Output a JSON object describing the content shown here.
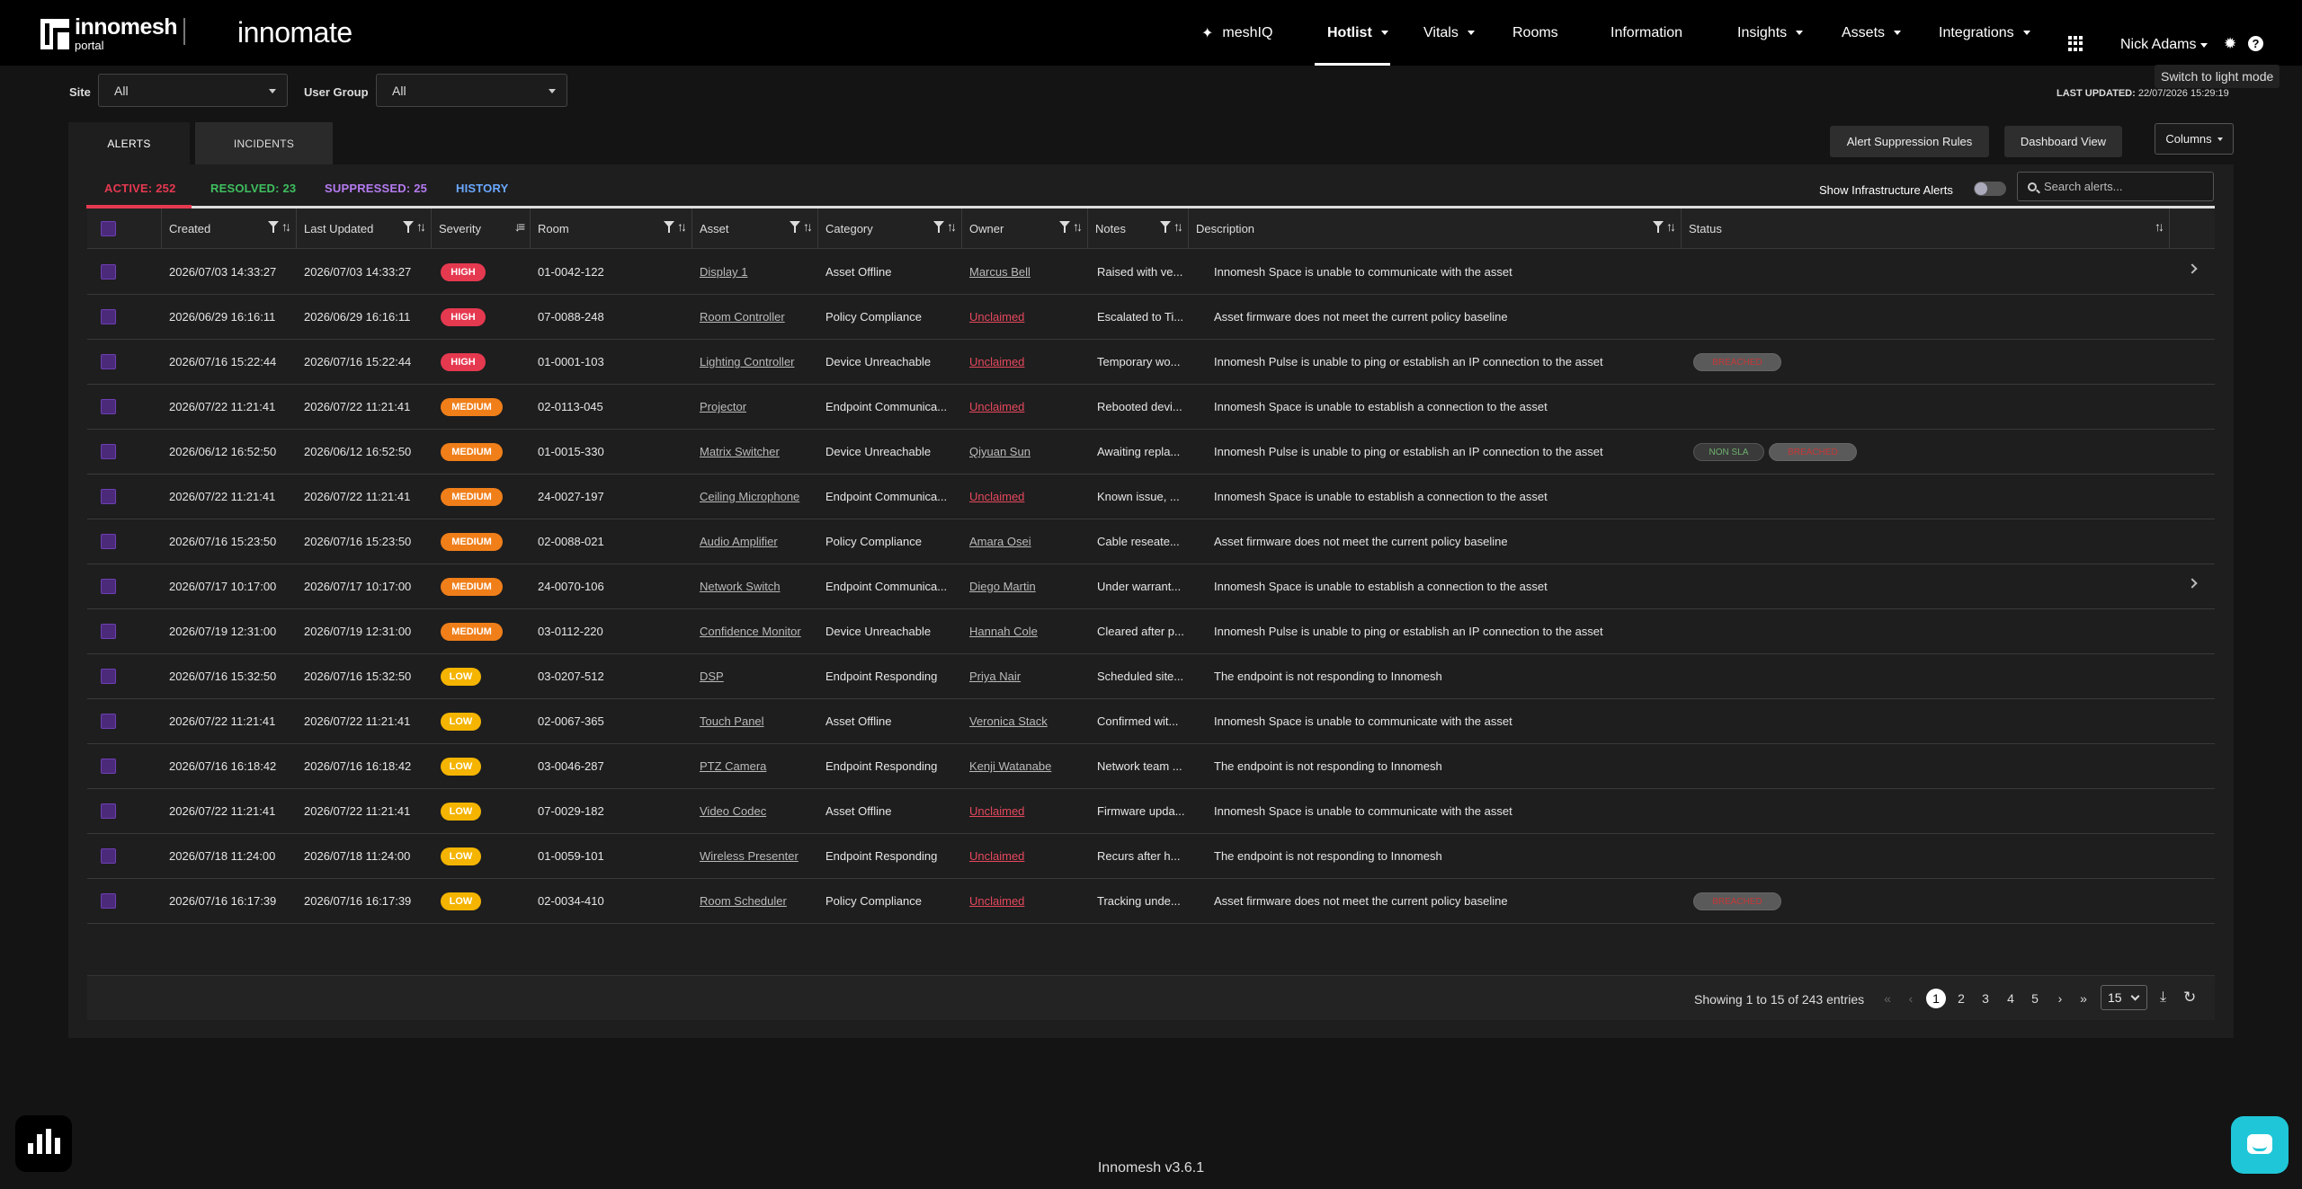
{
  "header": {
    "logo_brand": "innomesh",
    "logo_sub": "portal",
    "product": "innomate",
    "nav": [
      {
        "label": "meshIQ",
        "icon": "sparkle-icon"
      },
      {
        "label": "Hotlist",
        "active": true
      },
      {
        "label": "Vitals"
      },
      {
        "label": "Rooms"
      },
      {
        "label": "Information"
      },
      {
        "label": "Insights"
      },
      {
        "label": "Assets"
      },
      {
        "label": "Integrations"
      }
    ],
    "user": "Nick Adams",
    "tooltip": "Switch to light mode"
  },
  "filters": {
    "site_label": "Site",
    "site_value": "All",
    "group_label": "User Group",
    "group_value": "All",
    "last_updated_label": "LAST UPDATED:",
    "last_updated_value": "22/07/2026 15:29:19"
  },
  "tabs": [
    "ALERTS",
    "INCIDENTS"
  ],
  "buttons": {
    "suppression": "Alert Suppression Rules",
    "dashboard": "Dashboard View",
    "columns": "Columns"
  },
  "subtabs": {
    "active": "ACTIVE: 252",
    "resolved": "RESOLVED: 23",
    "suppressed": "SUPPRESSED: 25",
    "history": "HISTORY"
  },
  "colors": {
    "active": "#e53950",
    "resolved": "#3fbf5f",
    "suppressed": "#b57bf0",
    "history": "#6aa8ff"
  },
  "infra_label": "Show Infrastructure Alerts",
  "search_placeholder": "Search alerts...",
  "columns": [
    "Created",
    "Last Updated",
    "Severity",
    "Room",
    "Asset",
    "Category",
    "Owner",
    "Notes",
    "Description",
    "Status"
  ],
  "rows": [
    {
      "created": "2026/07/03 14:33:27",
      "updated": "2026/07/03 14:33:27",
      "severity": "HIGH",
      "room": "01-0042-122",
      "asset": "Display 1",
      "category": "Asset Offline",
      "owner": "Marcus Bell",
      "notes": "Raised with ve...",
      "description": "Innomesh Space is unable to communicate with the asset",
      "status": []
    },
    {
      "created": "2026/06/29 16:16:11",
      "updated": "2026/06/29 16:16:11",
      "severity": "HIGH",
      "room": "07-0088-248",
      "asset": "Room Controller",
      "category": "Policy Compliance",
      "owner": "Unclaimed",
      "notes": "Escalated to Ti...",
      "description": "Asset firmware does not meet the current policy baseline",
      "status": []
    },
    {
      "created": "2026/07/16 15:22:44",
      "updated": "2026/07/16 15:22:44",
      "severity": "HIGH",
      "room": "01-0001-103",
      "asset": "Lighting Controller",
      "category": "Device Unreachable",
      "owner": "Unclaimed",
      "notes": "Temporary wo...",
      "description": "Innomesh Pulse is unable to ping or establish an IP connection to the asset",
      "status": [
        "BREACHED"
      ]
    },
    {
      "created": "2026/07/22 11:21:41",
      "updated": "2026/07/22 11:21:41",
      "severity": "MEDIUM",
      "room": "02-0113-045",
      "asset": "Projector",
      "category": "Endpoint Communica...",
      "owner": "Unclaimed",
      "notes": "Rebooted devi...",
      "description": "Innomesh Space is unable to establish a connection to the asset",
      "status": []
    },
    {
      "created": "2026/06/12 16:52:50",
      "updated": "2026/06/12 16:52:50",
      "severity": "MEDIUM",
      "room": "01-0015-330",
      "asset": "Matrix Switcher",
      "category": "Device Unreachable",
      "owner": "Qiyuan Sun",
      "notes": "Awaiting repla...",
      "description": "Innomesh Pulse is unable to ping or establish an IP connection to the asset",
      "status": [
        "NON SLA",
        "BREACHED"
      ]
    },
    {
      "created": "2026/07/22 11:21:41",
      "updated": "2026/07/22 11:21:41",
      "severity": "MEDIUM",
      "room": "24-0027-197",
      "asset": "Ceiling Microphone",
      "category": "Endpoint Communica...",
      "owner": "Unclaimed",
      "notes": "Known issue, ...",
      "description": "Innomesh Space is unable to establish a connection to the asset",
      "status": []
    },
    {
      "created": "2026/07/16 15:23:50",
      "updated": "2026/07/16 15:23:50",
      "severity": "MEDIUM",
      "room": "02-0088-021",
      "asset": "Audio Amplifier",
      "category": "Policy Compliance",
      "owner": "Amara Osei",
      "notes": "Cable reseate...",
      "description": "Asset firmware does not meet the current policy baseline",
      "status": []
    },
    {
      "created": "2026/07/17 10:17:00",
      "updated": "2026/07/17 10:17:00",
      "severity": "MEDIUM",
      "room": "24-0070-106",
      "asset": "Network Switch",
      "category": "Endpoint Communica...",
      "owner": "Diego Martin",
      "notes": "Under warrant...",
      "description": "Innomesh Space is unable to establish a connection to the asset",
      "status": []
    },
    {
      "created": "2026/07/19 12:31:00",
      "updated": "2026/07/19 12:31:00",
      "severity": "MEDIUM",
      "room": "03-0112-220",
      "asset": "Confidence Monitor",
      "category": "Device Unreachable",
      "owner": "Hannah Cole",
      "notes": "Cleared after p...",
      "description": "Innomesh Pulse is unable to ping or establish an IP connection to the asset",
      "status": []
    },
    {
      "created": "2026/07/16 15:32:50",
      "updated": "2026/07/16 15:32:50",
      "severity": "LOW",
      "room": "03-0207-512",
      "asset": "DSP",
      "category": "Endpoint Responding",
      "owner": "Priya Nair",
      "notes": "Scheduled site...",
      "description": "The endpoint is not responding to Innomesh",
      "status": []
    },
    {
      "created": "2026/07/22 11:21:41",
      "updated": "2026/07/22 11:21:41",
      "severity": "LOW",
      "room": "02-0067-365",
      "asset": "Touch Panel",
      "category": "Asset Offline",
      "owner": "Veronica Stack",
      "notes": "Confirmed wit...",
      "description": "Innomesh Space is unable to communicate with the asset",
      "status": []
    },
    {
      "created": "2026/07/16 16:18:42",
      "updated": "2026/07/16 16:18:42",
      "severity": "LOW",
      "room": "03-0046-287",
      "asset": "PTZ Camera",
      "category": "Endpoint Responding",
      "owner": "Kenji Watanabe",
      "notes": "Network team ...",
      "description": "The endpoint is not responding to Innomesh",
      "status": []
    },
    {
      "created": "2026/07/22 11:21:41",
      "updated": "2026/07/22 11:21:41",
      "severity": "LOW",
      "room": "07-0029-182",
      "asset": "Video Codec",
      "category": "Asset Offline",
      "owner": "Unclaimed",
      "notes": "Firmware upda...",
      "description": "Innomesh Space is unable to communicate with the asset",
      "status": []
    },
    {
      "created": "2026/07/18 11:24:00",
      "updated": "2026/07/18 11:24:00",
      "severity": "LOW",
      "room": "01-0059-101",
      "asset": "Wireless Presenter",
      "category": "Endpoint Responding",
      "owner": "Unclaimed",
      "notes": "Recurs after h...",
      "description": "The endpoint is not responding to Innomesh",
      "status": []
    },
    {
      "created": "2026/07/16 16:17:39",
      "updated": "2026/07/16 16:17:39",
      "severity": "LOW",
      "room": "02-0034-410",
      "asset": "Room Scheduler",
      "category": "Policy Compliance",
      "owner": "Unclaimed",
      "notes": "Tracking unde...",
      "description": "Asset firmware does not meet the current policy baseline",
      "status": [
        "BREACHED"
      ]
    }
  ],
  "expandable_rows": [
    0,
    7
  ],
  "pagination": {
    "showing": "Showing 1 to 15 of 243 entries",
    "pages": [
      "1",
      "2",
      "3",
      "4",
      "5"
    ],
    "current": "1",
    "page_size": "15"
  },
  "footer": {
    "version": "Innomesh v3.6.1"
  }
}
